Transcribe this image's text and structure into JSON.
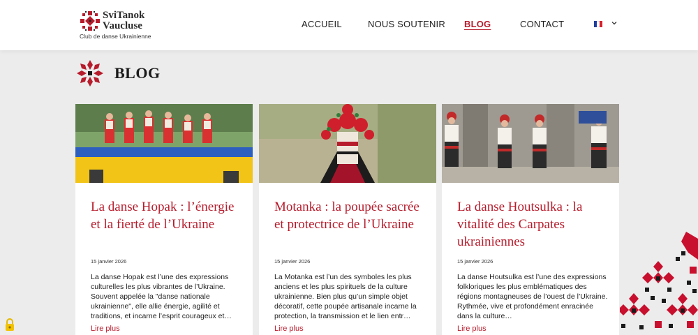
{
  "brand": {
    "title_line1": "SviTanok",
    "title_line2": "Vaucluse",
    "subtitle": "Club de danse Ukrainienne"
  },
  "nav": {
    "items": [
      {
        "label": "ACCUEIL"
      },
      {
        "label": "NOUS SOUTENIR"
      },
      {
        "label": "BLOG"
      },
      {
        "label": "CONTACT"
      }
    ],
    "active": "BLOG",
    "language_icon": "france-flag-icon"
  },
  "page": {
    "heading": "BLOG"
  },
  "posts": [
    {
      "title": "La danse Hopak : l’énergie et la fierté de l’Ukraine",
      "date": "15 janvier 2026",
      "excerpt": "La danse Hopak est l’une des expressions culturelles les plus vibrantes de l’Ukraine. Souvent appelée la \"danse nationale ukrainienne\", elle allie énergie, agilité et traditions, et incarne l’esprit courageux et…",
      "link": "Lire plus"
    },
    {
      "title": "Motanka : la poupée sacrée et protectrice de l’Ukraine",
      "date": "15 janvier 2026",
      "excerpt": "La Motanka est l’un des symboles les plus anciens et les plus spirituels de la culture ukrainienne. Bien plus qu’un simple objet décoratif, cette poupée artisanale incarne la protection, la transmission et le lien entr…",
      "link": "Lire plus"
    },
    {
      "title": "La danse Houtsulka : la vitalité des Carpates ukrainiennes",
      "date": "15 janvier 2026",
      "excerpt": "La danse Houtsulka est l’une des expressions folkloriques les plus emblématiques des régions montagneuses de l’ouest de l’Ukraine. Rythmée, vive et profondément enracinée dans la culture…",
      "link": "Lire plus"
    }
  ],
  "colors": {
    "accent": "#b71c2c",
    "background": "#ececec",
    "card": "#ffffff"
  }
}
